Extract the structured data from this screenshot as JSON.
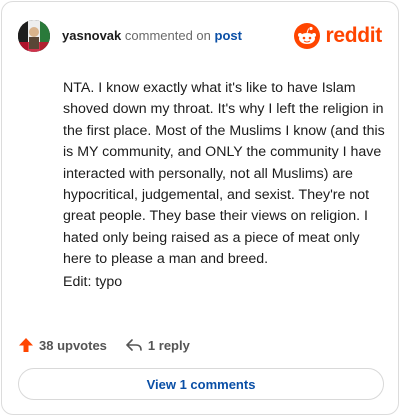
{
  "header": {
    "username": "yasnovak",
    "verb": "commented on",
    "post_link": "post",
    "brand": "reddit"
  },
  "comment": {
    "body": "NTA. I know exactly what it's like to have Islam shoved down my throat. It's why I left the religion in the first place. Most of the Muslims I know (and this is MY community, and ONLY the community I have interacted with personally, not all Muslims) are hypocritical, judgemental, and sexist. They're not great people. They base their views on religion. I hated only being raised as a piece of meat only here to please a man and breed.",
    "edit": "Edit: typo"
  },
  "actions": {
    "upvotes": "38 upvotes",
    "replies": "1 reply"
  },
  "footer": {
    "view_comments": "View 1 comments"
  },
  "icons": {
    "upvote": "upvote-arrow-icon",
    "reply": "reply-arrow-icon",
    "brand": "reddit-snoo-icon"
  },
  "colors": {
    "brand": "#ff4500",
    "link": "#0a4fa6",
    "upvote": "#ff4500"
  }
}
